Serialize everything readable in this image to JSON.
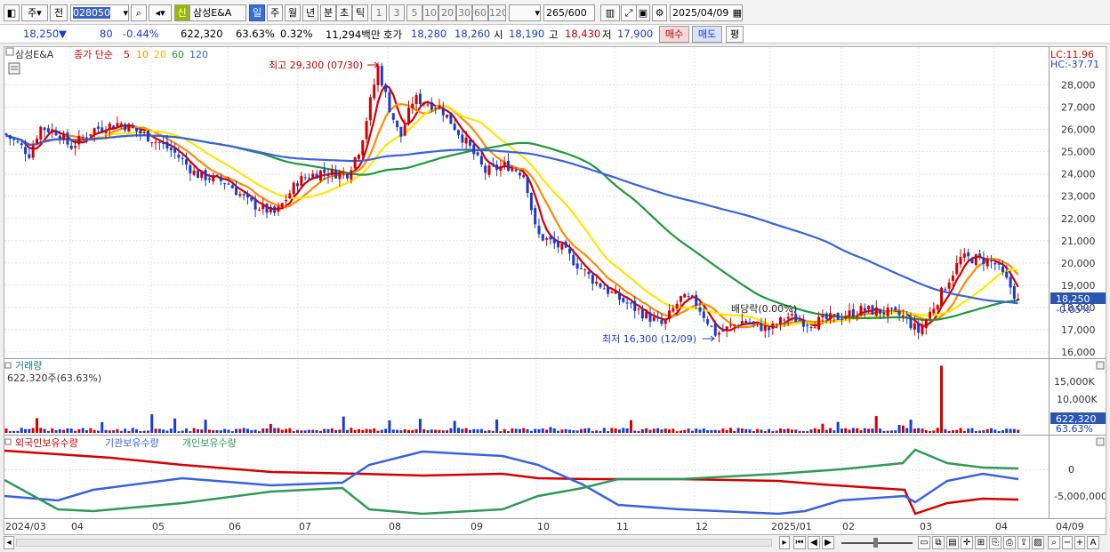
{
  "toolbar": {
    "period_prefix": "주",
    "prev_label": "전",
    "code": "028050",
    "credit_badge": "신",
    "stock_name": "삼성E&A",
    "periods": [
      "일",
      "주",
      "월",
      "년",
      "분",
      "초",
      "틱"
    ],
    "intervals": [
      "1",
      "3",
      "5",
      "10",
      "20",
      "30",
      "60",
      "120"
    ],
    "count_value": "265",
    "count_total": "/600",
    "date": "2025/04/09"
  },
  "quote": {
    "price": "18,250",
    "change": "80",
    "change_pct": "-0.44%",
    "volume": "622,320",
    "volume_ratio": "63.63%",
    "turnover_rate": "0.32%",
    "amount": "11,294백만",
    "hoga_label": "호가",
    "ask": "18,280",
    "bid": "18,260",
    "open_label": "시",
    "open": "18,190",
    "high_label": "고",
    "high": "18,430",
    "low_label": "저",
    "low": "17,900",
    "buy_label": "매수",
    "sell_label": "매도",
    "avg_label": "평"
  },
  "price_panel": {
    "stock_tag": "삼성E&A",
    "legend_title": "종가 단순",
    "ma_periods": [
      "5",
      "10",
      "20",
      "60",
      "120"
    ],
    "ma_colors": [
      "#d40000",
      "#ff8a00",
      "#ffe600",
      "#1f9a3a",
      "#3a62e0"
    ],
    "lc_label": "LC:11.96",
    "hc_label": "HC:-37.71",
    "max_annotation": "최고 29,300 (07/30)",
    "min_annotation": "최저 16,300 (12/09)",
    "dividend_annotation": "배당락(0.00%)",
    "price_tag": "18,250",
    "price_tag_pct": "-0.05%",
    "y_ticks": [
      "28,000",
      "27,000",
      "26,000",
      "25,000",
      "24,000",
      "23,000",
      "22,000",
      "21,000",
      "20,000",
      "19,000",
      "18,000",
      "17,000",
      "16,000"
    ]
  },
  "volume_panel": {
    "title": "거래량",
    "subtitle": "622,320주(63.63%)",
    "y_ticks": [
      "15,000K",
      "10,000K"
    ],
    "tag": "622,320",
    "tag_pct": "63.63%"
  },
  "holding_panel": {
    "legend": [
      "외국인보유수량",
      "기관보유수량",
      "개인보유수량"
    ],
    "legend_colors": [
      "#d40000",
      "#3a62e0",
      "#2f9a5a"
    ],
    "y_ticks": [
      "0",
      "-5,000,000"
    ]
  },
  "x_axis": [
    "2024/03",
    "04",
    "05",
    "06",
    "07",
    "08",
    "09",
    "10",
    "11",
    "12",
    "2025/01",
    "02",
    "03",
    "04",
    "04/09"
  ],
  "chart_data": {
    "type": "candlestick",
    "x": [
      "2024/03",
      "04",
      "05",
      "06",
      "07",
      "08",
      "09",
      "10",
      "11",
      "12",
      "2025/01",
      "02",
      "03",
      "04"
    ],
    "close_approx": [
      25800,
      25200,
      26000,
      24000,
      23000,
      26500,
      26500,
      24000,
      18500,
      17200,
      17700,
      17600,
      19800,
      18250
    ],
    "max": {
      "value": 29300,
      "date": "07/30"
    },
    "min": {
      "value": 16300,
      "date": "12/09"
    },
    "ylim": [
      15800,
      29700
    ]
  }
}
